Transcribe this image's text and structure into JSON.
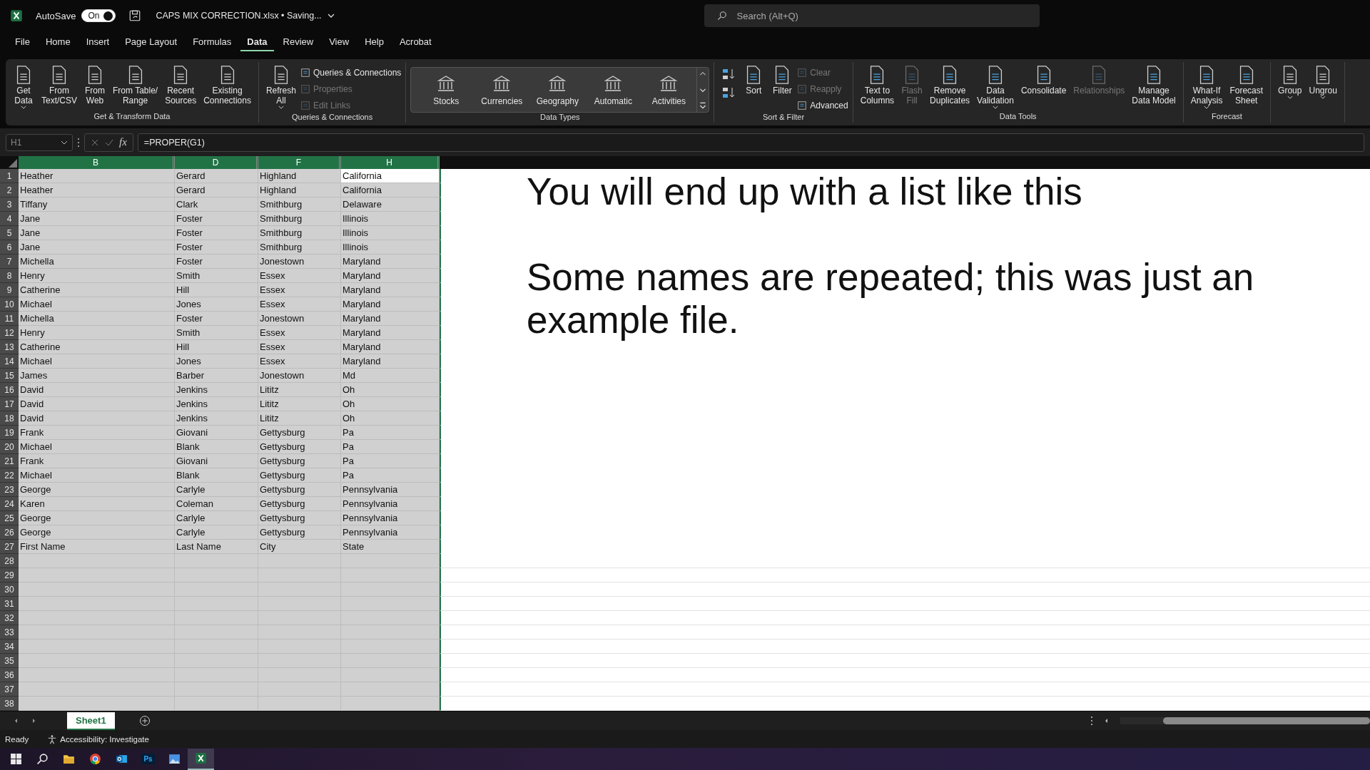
{
  "title_bar": {
    "autosave_label": "AutoSave",
    "autosave": {
      "label": "On",
      "on": true
    },
    "document_title": "CAPS MIX CORRECTION.xlsx • Saving...",
    "search": {
      "placeholder": "Search (Alt+Q)"
    }
  },
  "tabs": [
    {
      "label": "File",
      "selected": false
    },
    {
      "label": "Home",
      "selected": false
    },
    {
      "label": "Insert",
      "selected": false
    },
    {
      "label": "Page Layout",
      "selected": false
    },
    {
      "label": "Formulas",
      "selected": false
    },
    {
      "label": "Data",
      "selected": true
    },
    {
      "label": "Review",
      "selected": false
    },
    {
      "label": "View",
      "selected": false
    },
    {
      "label": "Help",
      "selected": false
    },
    {
      "label": "Acrobat",
      "selected": false
    }
  ],
  "ribbon": [
    {
      "label": "Get & Transform Data",
      "items": [
        {
          "kind": "large",
          "label": "Get\nData",
          "dropdown": true,
          "disabled": false
        },
        {
          "kind": "large",
          "label": "From\nText/CSV",
          "dropdown": false,
          "disabled": false
        },
        {
          "kind": "large",
          "label": "From\nWeb",
          "dropdown": false,
          "disabled": false
        },
        {
          "kind": "large",
          "label": "From Table/\nRange",
          "dropdown": false,
          "disabled": false
        },
        {
          "kind": "large",
          "label": "Recent\nSources",
          "dropdown": false,
          "disabled": false
        },
        {
          "kind": "large",
          "label": "Existing\nConnections",
          "dropdown": false,
          "disabled": false
        }
      ]
    },
    {
      "label": "Queries & Connections",
      "items": [
        {
          "kind": "large",
          "label": "Refresh\nAll",
          "dropdown": true,
          "disabled": false
        },
        {
          "kind": "stack",
          "items": [
            {
              "label": "Queries & Connections",
              "disabled": false
            },
            {
              "label": "Properties",
              "disabled": true
            },
            {
              "label": "Edit Links",
              "disabled": true
            }
          ]
        }
      ]
    },
    {
      "label": "Data Types",
      "items": [
        {
          "kind": "gallery",
          "items": [
            {
              "label": "Stocks"
            },
            {
              "label": "Currencies"
            },
            {
              "label": "Geography"
            },
            {
              "label": "Automatic"
            },
            {
              "label": "Activities"
            }
          ]
        }
      ]
    },
    {
      "label": "Sort & Filter",
      "items": [
        {
          "kind": "sort_pair"
        },
        {
          "kind": "large",
          "label": "Sort",
          "dropdown": false,
          "disabled": false
        },
        {
          "kind": "large",
          "label": "Filter",
          "dropdown": false,
          "disabled": false
        },
        {
          "kind": "stack",
          "items": [
            {
              "label": "Clear",
              "disabled": true
            },
            {
              "label": "Reapply",
              "disabled": true
            },
            {
              "label": "Advanced",
              "disabled": false
            }
          ]
        }
      ]
    },
    {
      "label": "Data Tools",
      "items": [
        {
          "kind": "large",
          "label": "Text to\nColumns",
          "dropdown": false,
          "disabled": false
        },
        {
          "kind": "large",
          "label": "Flash\nFill",
          "dropdown": false,
          "disabled": true
        },
        {
          "kind": "large",
          "label": "Remove\nDuplicates",
          "dropdown": false,
          "disabled": false
        },
        {
          "kind": "large",
          "label": "Data\nValidation",
          "dropdown": true,
          "disabled": false
        },
        {
          "kind": "large",
          "label": "Consolidate",
          "dropdown": false,
          "disabled": false
        },
        {
          "kind": "large",
          "label": "Relationships",
          "dropdown": false,
          "disabled": true
        },
        {
          "kind": "large",
          "label": "Manage\nData Model",
          "dropdown": false,
          "disabled": false
        }
      ]
    },
    {
      "label": "Forecast",
      "items": [
        {
          "kind": "large",
          "label": "What-If\nAnalysis",
          "dropdown": true,
          "disabled": false
        },
        {
          "kind": "large",
          "label": "Forecast\nSheet",
          "dropdown": false,
          "disabled": false
        }
      ]
    },
    {
      "items": [
        {
          "kind": "large",
          "label": "Group",
          "dropdown": true,
          "disabled": false
        },
        {
          "kind": "large",
          "label": "Ungrou",
          "dropdown": true,
          "disabled": false
        }
      ]
    }
  ],
  "formula_bar": {
    "name_box": "H1",
    "function_label": "fx",
    "formula": "=PROPER(G1)"
  },
  "columns": [
    {
      "label": "B",
      "selected": true
    },
    {
      "label": "D",
      "selected": true
    },
    {
      "label": "F",
      "selected": true
    },
    {
      "label": "H",
      "selected": true
    }
  ],
  "rows": [
    {
      "number": "1",
      "active": true,
      "cells": [
        "Heather",
        "Gerard",
        "Highland",
        "California"
      ]
    },
    {
      "number": "2",
      "active": false,
      "cells": [
        "Heather",
        "Gerard",
        "Highland",
        "California"
      ]
    },
    {
      "number": "3",
      "active": false,
      "cells": [
        "Tiffany",
        "Clark",
        "Smithburg",
        "Delaware"
      ]
    },
    {
      "number": "4",
      "active": false,
      "cells": [
        "Jane",
        "Foster",
        "Smithburg",
        "Illinois"
      ]
    },
    {
      "number": "5",
      "active": false,
      "cells": [
        "Jane",
        "Foster",
        "Smithburg",
        "Illinois"
      ]
    },
    {
      "number": "6",
      "active": false,
      "cells": [
        "Jane",
        "Foster",
        "Smithburg",
        "Illinois"
      ]
    },
    {
      "number": "7",
      "active": false,
      "cells": [
        "Michella",
        "Foster",
        "Jonestown",
        "Maryland"
      ]
    },
    {
      "number": "8",
      "active": false,
      "cells": [
        "Henry",
        "Smith",
        "Essex",
        "Maryland"
      ]
    },
    {
      "number": "9",
      "active": false,
      "cells": [
        "Catherine",
        "Hill",
        "Essex",
        "Maryland"
      ]
    },
    {
      "number": "10",
      "active": false,
      "cells": [
        "Michael",
        "Jones",
        "Essex",
        "Maryland"
      ]
    },
    {
      "number": "11",
      "active": false,
      "cells": [
        "Michella",
        "Foster",
        "Jonestown",
        "Maryland"
      ]
    },
    {
      "number": "12",
      "active": false,
      "cells": [
        "Henry",
        "Smith",
        "Essex",
        "Maryland"
      ]
    },
    {
      "number": "13",
      "active": false,
      "cells": [
        "Catherine",
        "Hill",
        "Essex",
        "Maryland"
      ]
    },
    {
      "number": "14",
      "active": false,
      "cells": [
        "Michael",
        "Jones",
        "Essex",
        "Maryland"
      ]
    },
    {
      "number": "15",
      "active": false,
      "cells": [
        "James",
        "Barber",
        "Jonestown",
        "Md"
      ]
    },
    {
      "number": "16",
      "active": false,
      "cells": [
        "David",
        "Jenkins",
        "Lititz",
        "Oh"
      ]
    },
    {
      "number": "17",
      "active": false,
      "cells": [
        "David",
        "Jenkins",
        "Lititz",
        "Oh"
      ]
    },
    {
      "number": "18",
      "active": false,
      "cells": [
        "David",
        "Jenkins",
        "Lititz",
        "Oh"
      ]
    },
    {
      "number": "19",
      "active": false,
      "cells": [
        "Frank",
        "Giovani",
        "Gettysburg",
        "Pa"
      ]
    },
    {
      "number": "20",
      "active": false,
      "cells": [
        "Michael",
        "Blank",
        "Gettysburg",
        "Pa"
      ]
    },
    {
      "number": "21",
      "active": false,
      "cells": [
        "Frank",
        "Giovani",
        "Gettysburg",
        "Pa"
      ]
    },
    {
      "number": "22",
      "active": false,
      "cells": [
        "Michael",
        "Blank",
        "Gettysburg",
        "Pa"
      ]
    },
    {
      "number": "23",
      "active": false,
      "cells": [
        "George",
        "Carlyle",
        "Gettysburg",
        "Pennsylvania"
      ]
    },
    {
      "number": "24",
      "active": false,
      "cells": [
        "Karen",
        "Coleman",
        "Gettysburg",
        "Pennsylvania"
      ]
    },
    {
      "number": "25",
      "active": false,
      "cells": [
        "George",
        "Carlyle",
        "Gettysburg",
        "Pennsylvania"
      ]
    },
    {
      "number": "26",
      "active": false,
      "cells": [
        "George",
        "Carlyle",
        "Gettysburg",
        "Pennsylvania"
      ]
    },
    {
      "number": "27",
      "active": false,
      "cells": [
        "First Name",
        "Last Name",
        "City",
        "State"
      ]
    },
    {
      "number": "28",
      "active": false
    },
    {
      "number": "29",
      "active": false
    },
    {
      "number": "30",
      "active": false
    },
    {
      "number": "31",
      "active": false
    },
    {
      "number": "32",
      "active": false
    },
    {
      "number": "33",
      "active": false
    },
    {
      "number": "34",
      "active": false
    },
    {
      "number": "35",
      "active": false
    },
    {
      "number": "36",
      "active": false
    },
    {
      "number": "37",
      "active": false
    },
    {
      "number": "38",
      "active": false
    }
  ],
  "text_box": {
    "paragraphs": [
      "You will end up with a list like this",
      "Some names are repeated; this was just an example file."
    ]
  },
  "sheet_tabs": [
    {
      "label": "Sheet1",
      "selected": true
    }
  ],
  "status_bar": {
    "mode": "Ready",
    "accessibility": "Accessibility: Investigate"
  },
  "taskbar": {
    "items": [
      {
        "kind": "start",
        "selected": false
      },
      {
        "kind": "search",
        "selected": false
      },
      {
        "kind": "folder",
        "selected": false
      },
      {
        "kind": "browser",
        "selected": false
      },
      {
        "kind": "mail",
        "selected": false
      },
      {
        "kind": "photoshop",
        "label": "Ps",
        "selected": false
      },
      {
        "kind": "photos",
        "selected": false
      },
      {
        "kind": "excel",
        "selected": true
      }
    ]
  }
}
